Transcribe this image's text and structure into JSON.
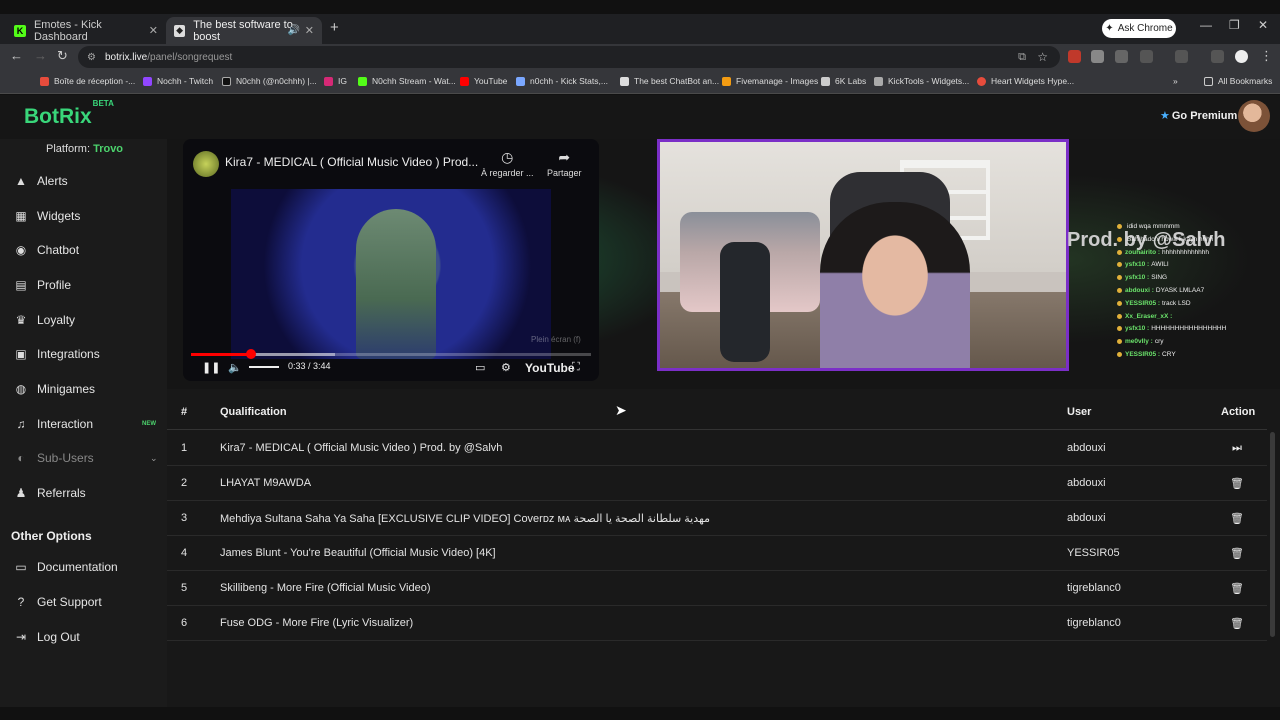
{
  "browser": {
    "tabs": [
      {
        "title": "Emotes - Kick Dashboard",
        "icon": "kick-icon"
      },
      {
        "title": "The best software to boost",
        "icon": "botrix-icon"
      }
    ],
    "new_tab": "+",
    "ask_chrome": "Ask Chrome",
    "url_host": "botrix.live",
    "url_path": "/panel/songrequest",
    "bookmarks": [
      "Boîte de réception -...",
      "Nochh - Twitch",
      "N0chh (@n0chhh) |...",
      "IG",
      "N0chh Stream - Wat...",
      "YouTube",
      "n0chh - Kick Stats,...",
      "The best ChatBot an...",
      "Fivemanage - Images",
      "6K Labs",
      "KickTools - Widgets...",
      "Heart Widgets Hype..."
    ],
    "all_bookmarks": "All Bookmarks"
  },
  "header": {
    "logo": "BotRix",
    "beta": "BETA",
    "premium": "Go Premium"
  },
  "sidebar": {
    "platform_label": "Platform:",
    "platform_value": "Trovo",
    "items": [
      {
        "label": "Alerts",
        "icon": "bell-icon"
      },
      {
        "label": "Widgets",
        "icon": "grid-icon"
      },
      {
        "label": "Chatbot",
        "icon": "robot-icon"
      },
      {
        "label": "Profile",
        "icon": "id-card-icon"
      },
      {
        "label": "Loyalty",
        "icon": "trophy-icon"
      },
      {
        "label": "Integrations",
        "icon": "integrations-icon"
      },
      {
        "label": "Minigames",
        "icon": "gamepad-icon"
      },
      {
        "label": "Interaction",
        "icon": "music-icon",
        "badge": "NEW"
      },
      {
        "label": "Sub-Users",
        "icon": "users-icon"
      },
      {
        "label": "Referrals",
        "icon": "referrals-icon"
      }
    ],
    "other_title": "Other Options",
    "other_items": [
      {
        "label": "Documentation",
        "icon": "book-icon"
      },
      {
        "label": "Get Support",
        "icon": "question-icon"
      },
      {
        "label": "Log Out",
        "icon": "logout-icon"
      }
    ]
  },
  "video": {
    "title": "Kira7 - MEDICAL ( Official Music Video ) Prod...",
    "watch_later": "À regarder ...",
    "share": "Partager",
    "time": "0:33 / 3:44",
    "brand": "YouTube",
    "watermark": "Plein écran (f)",
    "progress": 0.15,
    "buffered": 0.36
  },
  "chat_overlay": {
    "big_text": "Prod. by @Salvh",
    "lines": [
      {
        "user": "",
        "text": "idid wqa mmmmm"
      },
      {
        "user": "",
        "text": "Bah hadchi howa li kayn hhhh"
      },
      {
        "user": "zouhairito :",
        "text": "hhhhhhhhhhhhh"
      },
      {
        "user": "ysfx10 :",
        "text": "AWILI"
      },
      {
        "user": "ysfx10 :",
        "text": "SING"
      },
      {
        "user": "abdouxi :",
        "text": "DYASK LMLAA7"
      },
      {
        "user": "YESSIR05 :",
        "text": "track LSD"
      },
      {
        "user": "Xx_Eraser_xX :",
        "text": ""
      },
      {
        "user": "ysfx10 :",
        "text": "HHHHHHHHHHHHHHHH"
      },
      {
        "user": "me0vlly :",
        "text": "cry"
      },
      {
        "user": "YESSIR05 :",
        "text": "CRY"
      }
    ]
  },
  "table": {
    "columns": [
      "#",
      "Qualification",
      "User",
      "Action"
    ],
    "rows": [
      {
        "n": "1",
        "title": "Kira7 - MEDICAL ( Official Music Video ) Prod. by @Salvh",
        "user": "abdouxi",
        "action": "skip"
      },
      {
        "n": "2",
        "title": "LHAYAT M9AWDA",
        "user": "abdouxi",
        "action": "delete"
      },
      {
        "n": "3",
        "title": "Mehdiya Sultana Saha Ya Saha [EXCLUSIVE CLIP VIDEO] Coverᴅᴢ ᴍᴀ مهدية سلطانة الصحة يا الصحة",
        "user": "abdouxi",
        "action": "delete"
      },
      {
        "n": "4",
        "title": "James Blunt - You're Beautiful (Official Music Video) [4K]",
        "user": "YESSIR05",
        "action": "delete"
      },
      {
        "n": "5",
        "title": "Skillibeng - More Fire (Official Music Video)",
        "user": "tigreblanc0",
        "action": "delete"
      },
      {
        "n": "6",
        "title": "Fuse ODG - More Fire (Lyric Visualizer)",
        "user": "tigreblanc0",
        "action": "delete"
      }
    ]
  }
}
